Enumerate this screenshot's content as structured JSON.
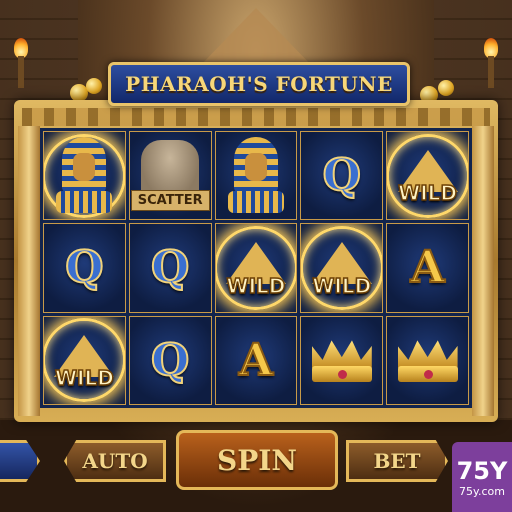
{
  "game": {
    "title": "PHARAOH'S FORTUNE"
  },
  "reels": [
    [
      "pharaoh",
      "q",
      "wild"
    ],
    [
      "scatter",
      "q",
      "q"
    ],
    [
      "pharaoh",
      "wild",
      "a"
    ],
    [
      "q",
      "wild",
      "crown"
    ],
    [
      "wild",
      "a",
      "crown"
    ]
  ],
  "symbols": {
    "q_label": "Q",
    "a_label": "A",
    "wild_label": "WILD",
    "scatter_label": "SCATTER"
  },
  "controls": {
    "auto_label": "AUTO",
    "spin_label": "SPIN",
    "bet_label": "BET"
  },
  "badge": {
    "main": "75Y",
    "sub": "75y.com"
  },
  "colors": {
    "reel_background": "#12244d",
    "frame_gold": "#e0b962",
    "title_blue": "#2d4ea0",
    "badge_purple": "#7d3f9c"
  }
}
